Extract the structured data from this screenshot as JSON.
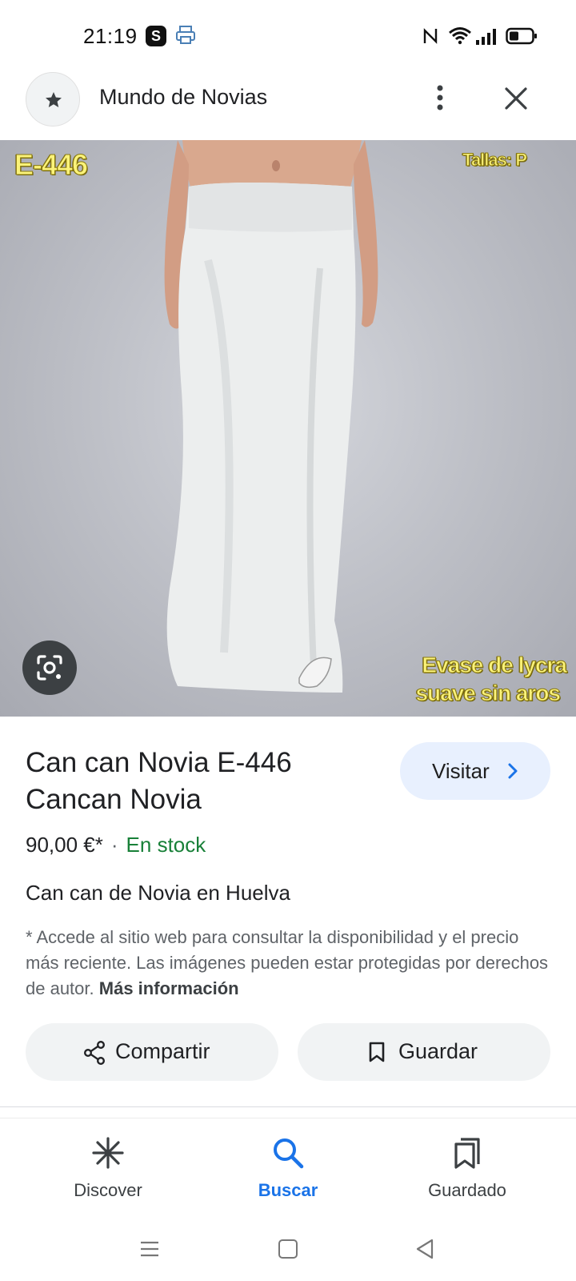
{
  "status_bar": {
    "time": "21:19",
    "app_badge": "S"
  },
  "header": {
    "site_name": "Mundo de Novias"
  },
  "image": {
    "overlay_code": "E-446",
    "overlay_sizes": "Tallas: P",
    "overlay_desc_line1": "Evase de lycra",
    "overlay_desc_line2": "suave sin aros"
  },
  "product": {
    "title": "Can can Novia E-446 Cancan Novia",
    "visit_label": "Visitar",
    "price": "90,00 €*",
    "separator": "·",
    "availability": "En stock",
    "subtitle": "Can can de Novia en Huelva",
    "disclaimer": "* Accede al sitio web para consultar la disponibilidad y el precio más reciente. Las imágenes pueden estar protegidas por derechos de autor.",
    "disclaimer_link": "Más información"
  },
  "actions": {
    "share_label": "Compartir",
    "save_label": "Guardar"
  },
  "bottom_nav": {
    "items": [
      {
        "label": "Discover",
        "icon": "discover-asterisk-icon"
      },
      {
        "label": "Buscar",
        "icon": "search-icon",
        "active": true
      },
      {
        "label": "Guardado",
        "icon": "saved-collections-icon"
      }
    ]
  },
  "colors": {
    "accent": "#1a73e8",
    "stock_green": "#188038",
    "visit_button_bg": "#e8f0fe",
    "action_button_bg": "#f1f3f4",
    "overlay_text": "#fbf37a"
  }
}
